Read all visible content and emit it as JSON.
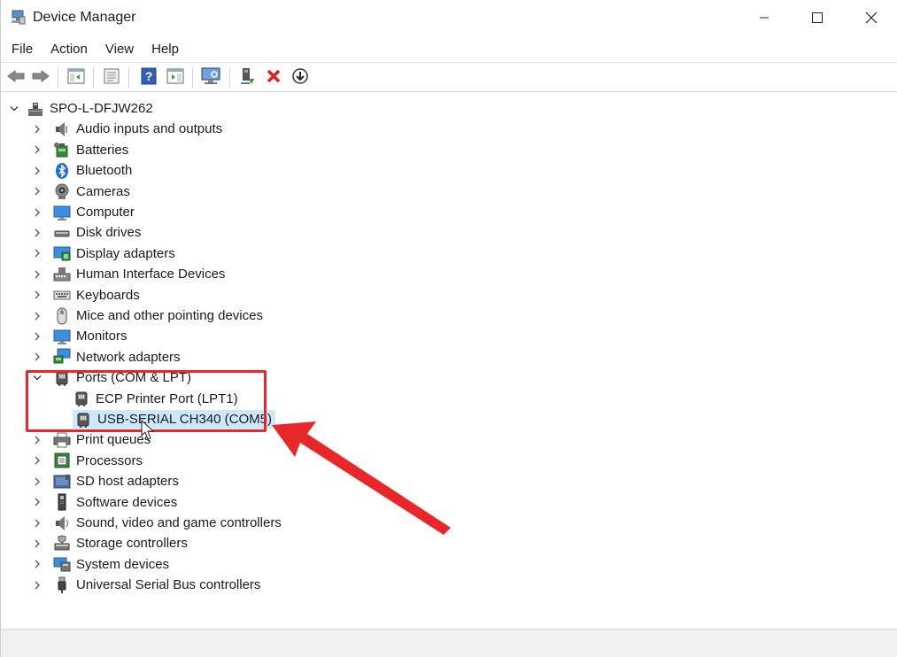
{
  "window": {
    "title": "Device Manager"
  },
  "menu": [
    {
      "label": "File"
    },
    {
      "label": "Action"
    },
    {
      "label": "View"
    },
    {
      "label": "Help"
    }
  ],
  "toolbar": {
    "buttons": [
      {
        "name": "back-arrow-icon"
      },
      {
        "name": "forward-arrow-icon"
      },
      {
        "name": "show-hide-console-tree-icon"
      },
      {
        "name": "properties-icon"
      },
      {
        "name": "help-icon"
      },
      {
        "name": "action-pane-icon"
      },
      {
        "name": "scan-hardware-icon"
      },
      {
        "name": "update-driver-icon"
      },
      {
        "name": "uninstall-device-icon"
      },
      {
        "name": "download-icon"
      }
    ]
  },
  "tree": {
    "root": "SPO-L-DFJW262",
    "categories": [
      {
        "label": "Audio inputs and outputs",
        "icon": "speaker-icon"
      },
      {
        "label": "Batteries",
        "icon": "battery-icon"
      },
      {
        "label": "Bluetooth",
        "icon": "bluetooth-icon"
      },
      {
        "label": "Cameras",
        "icon": "camera-icon"
      },
      {
        "label": "Computer",
        "icon": "computer-icon"
      },
      {
        "label": "Disk drives",
        "icon": "disk-drive-icon"
      },
      {
        "label": "Display adapters",
        "icon": "display-adapter-icon"
      },
      {
        "label": "Human Interface Devices",
        "icon": "hid-icon"
      },
      {
        "label": "Keyboards",
        "icon": "keyboard-icon"
      },
      {
        "label": "Mice and other pointing devices",
        "icon": "mouse-icon"
      },
      {
        "label": "Monitors",
        "icon": "monitor-icon"
      },
      {
        "label": "Network adapters",
        "icon": "network-adapter-icon"
      },
      {
        "label": "Ports (COM & LPT)",
        "icon": "port-icon",
        "expanded": true,
        "children": [
          {
            "label": "ECP Printer Port (LPT1)",
            "icon": "port-icon"
          },
          {
            "label": "USB-SERIAL CH340 (COM5)",
            "icon": "port-icon",
            "selected": true
          }
        ]
      },
      {
        "label": "Print queues",
        "icon": "printer-icon"
      },
      {
        "label": "Processors",
        "icon": "processor-icon"
      },
      {
        "label": "SD host adapters",
        "icon": "sd-card-icon"
      },
      {
        "label": "Software devices",
        "icon": "software-device-icon"
      },
      {
        "label": "Sound, video and game controllers",
        "icon": "sound-controller-icon"
      },
      {
        "label": "Storage controllers",
        "icon": "storage-controller-icon"
      },
      {
        "label": "System devices",
        "icon": "system-devices-icon"
      },
      {
        "label": "Universal Serial Bus controllers",
        "icon": "usb-icon"
      }
    ]
  },
  "colors": {
    "selection": "#cce8ff",
    "annotation_red": "#e8272a"
  }
}
